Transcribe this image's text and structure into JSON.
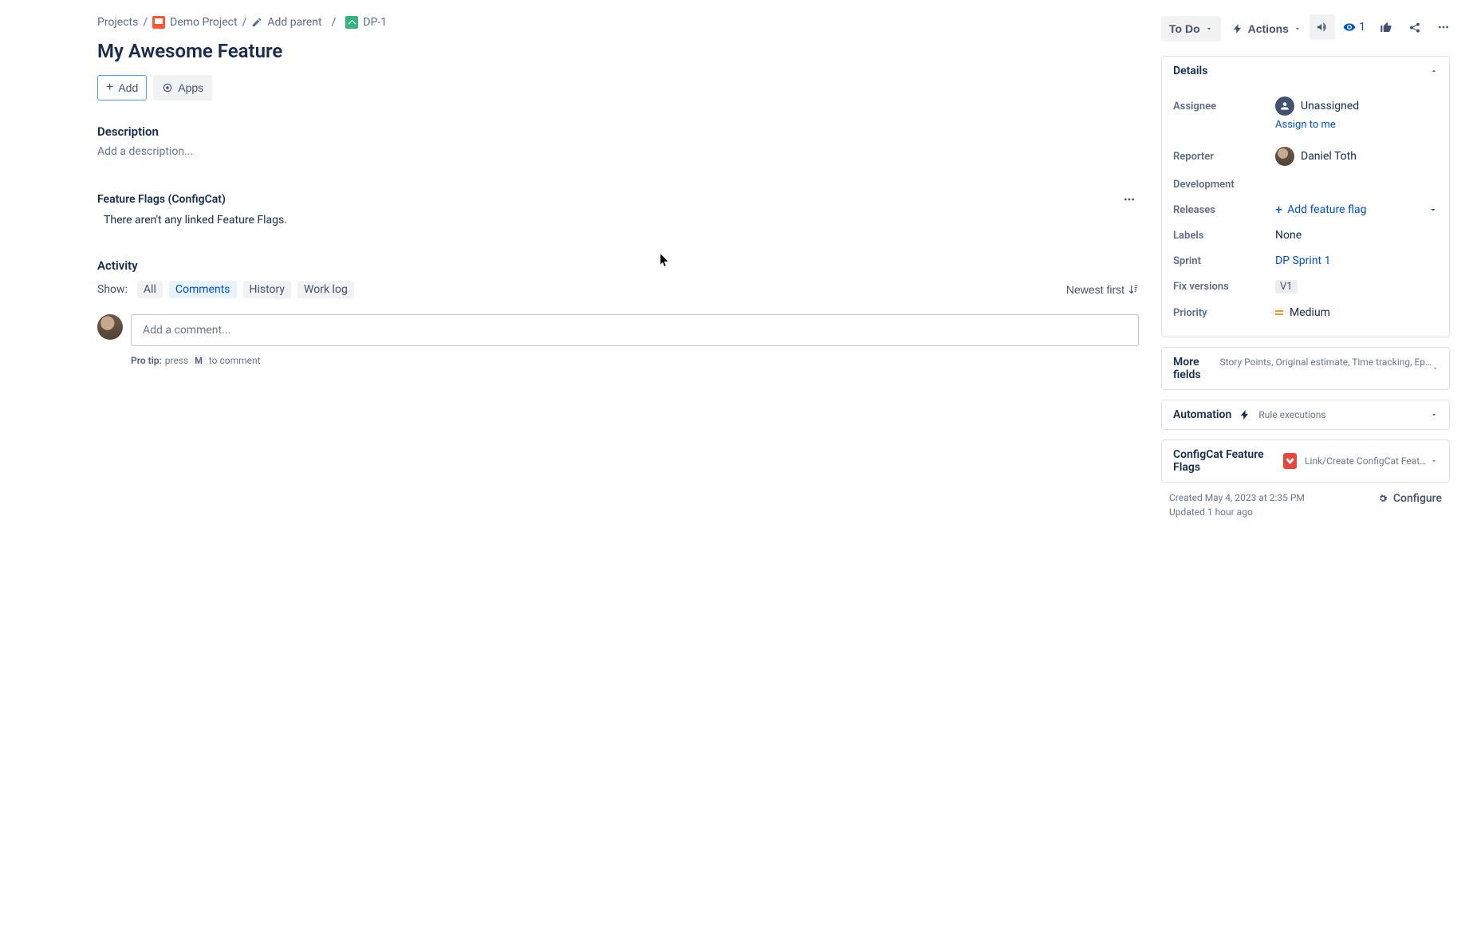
{
  "breadcrumb": {
    "projects": "Projects",
    "project_name": "Demo Project",
    "add_parent": "Add parent",
    "issue_key": "DP-1"
  },
  "top_actions": {
    "watcher_count": "1"
  },
  "title": "My Awesome Feature",
  "buttons": {
    "add": "Add",
    "apps": "Apps"
  },
  "description": {
    "heading": "Description",
    "placeholder": "Add a description..."
  },
  "feature_flags_panel": {
    "title": "Feature Flags (ConfigCat)",
    "empty": "There aren't any linked Feature Flags."
  },
  "activity": {
    "heading": "Activity",
    "show_label": "Show:",
    "tabs": {
      "all": "All",
      "comments": "Comments",
      "history": "History",
      "worklog": "Work log"
    },
    "sort": "Newest first",
    "comment_placeholder": "Add a comment...",
    "protip_label": "Pro tip:",
    "protip_press": "press",
    "protip_key": "M",
    "protip_rest": "to comment"
  },
  "side": {
    "status": "To Do",
    "actions": "Actions",
    "details": {
      "title": "Details",
      "assignee_label": "Assignee",
      "assignee_value": "Unassigned",
      "assign_to_me": "Assign to me",
      "reporter_label": "Reporter",
      "reporter_value": "Daniel Toth",
      "development_label": "Development",
      "releases_label": "Releases",
      "add_ff": "Add feature flag",
      "labels_label": "Labels",
      "labels_value": "None",
      "sprint_label": "Sprint",
      "sprint_value": "DP Sprint 1",
      "fixv_label": "Fix versions",
      "fixv_value": "V1",
      "priority_label": "Priority",
      "priority_value": "Medium"
    },
    "more_fields": {
      "title": "More fields",
      "sub": "Story Points, Original estimate, Time tracking, Epic Link, Compone..."
    },
    "automation": {
      "title": "Automation",
      "sub": "Rule executions"
    },
    "configcat": {
      "title": "ConfigCat Feature Flags",
      "sub": "Link/Create ConfigCat Feature Flag"
    },
    "meta": {
      "created": "Created May 4, 2023 at 2:35 PM",
      "updated": "Updated 1 hour ago",
      "configure": "Configure"
    }
  }
}
